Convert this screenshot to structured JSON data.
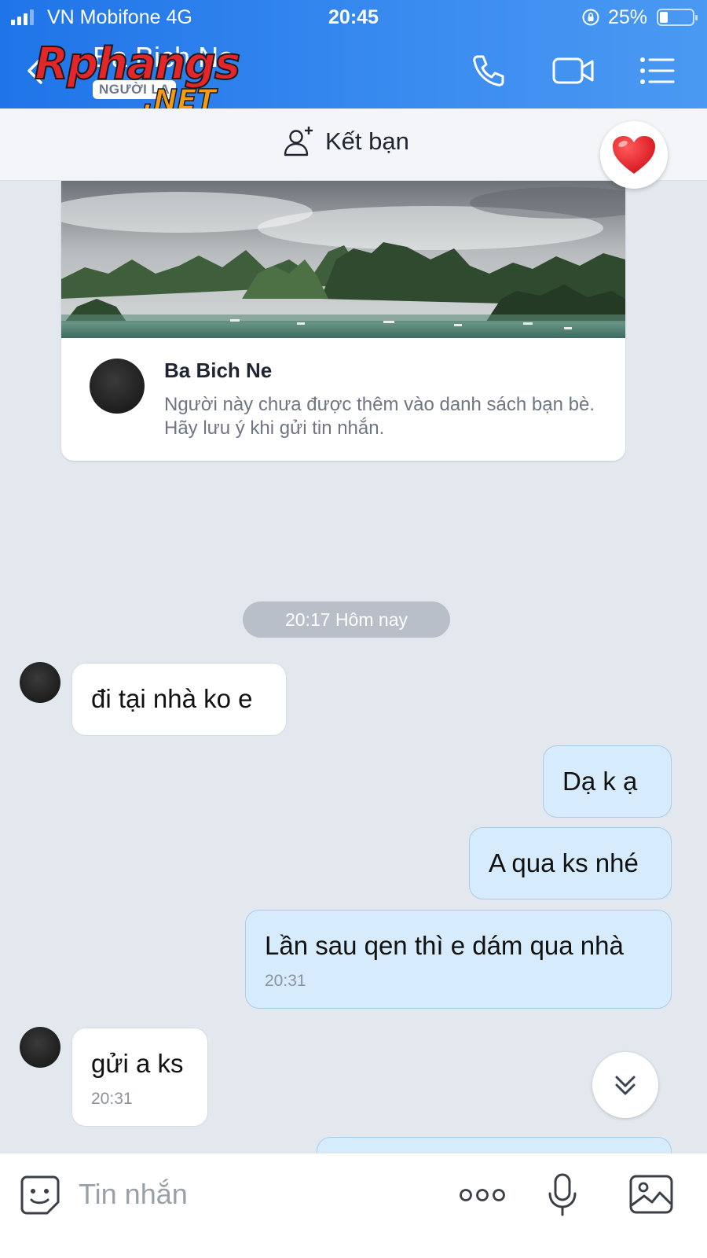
{
  "status_bar": {
    "carrier": "VN Mobifone  4G",
    "time": "20:45",
    "battery": "25%",
    "battery_level": 0.25,
    "signal_bars": 3
  },
  "header": {
    "contact_name": "Ba Bich Ne",
    "stranger_label": "NGƯỜI LẠ",
    "icons": [
      "back-icon",
      "phone-icon",
      "video-icon",
      "menu-icon"
    ]
  },
  "watermark": {
    "main": "Rphangs",
    "suffix": ".NET"
  },
  "friend_bar": {
    "add_friend_label": "Kết bạn"
  },
  "profile_card": {
    "name": "Ba Bich Ne",
    "description": "Người này chưa được thêm vào danh sách bạn bè. Hãy lưu ý khi gửi tin nhắn."
  },
  "date_separator": "20:17 Hôm nay",
  "messages": [
    {
      "direction": "in",
      "text": "đi tại nhà ko e",
      "time": ""
    },
    {
      "direction": "out",
      "text": "Dạ k ạ",
      "time": ""
    },
    {
      "direction": "out",
      "text": "A qua ks nhé",
      "time": ""
    },
    {
      "direction": "out",
      "text": "Lần sau qen thì e dám qua nhà",
      "time": "20:31"
    },
    {
      "direction": "in",
      "text": "gửi a ks",
      "time": "20:31"
    }
  ],
  "input_bar": {
    "placeholder": "Tin nhắn"
  },
  "colors": {
    "header_blue": "#2a80ec",
    "outgoing_bubble": "#d6ecfc",
    "chat_background": "#e3e7ee"
  }
}
